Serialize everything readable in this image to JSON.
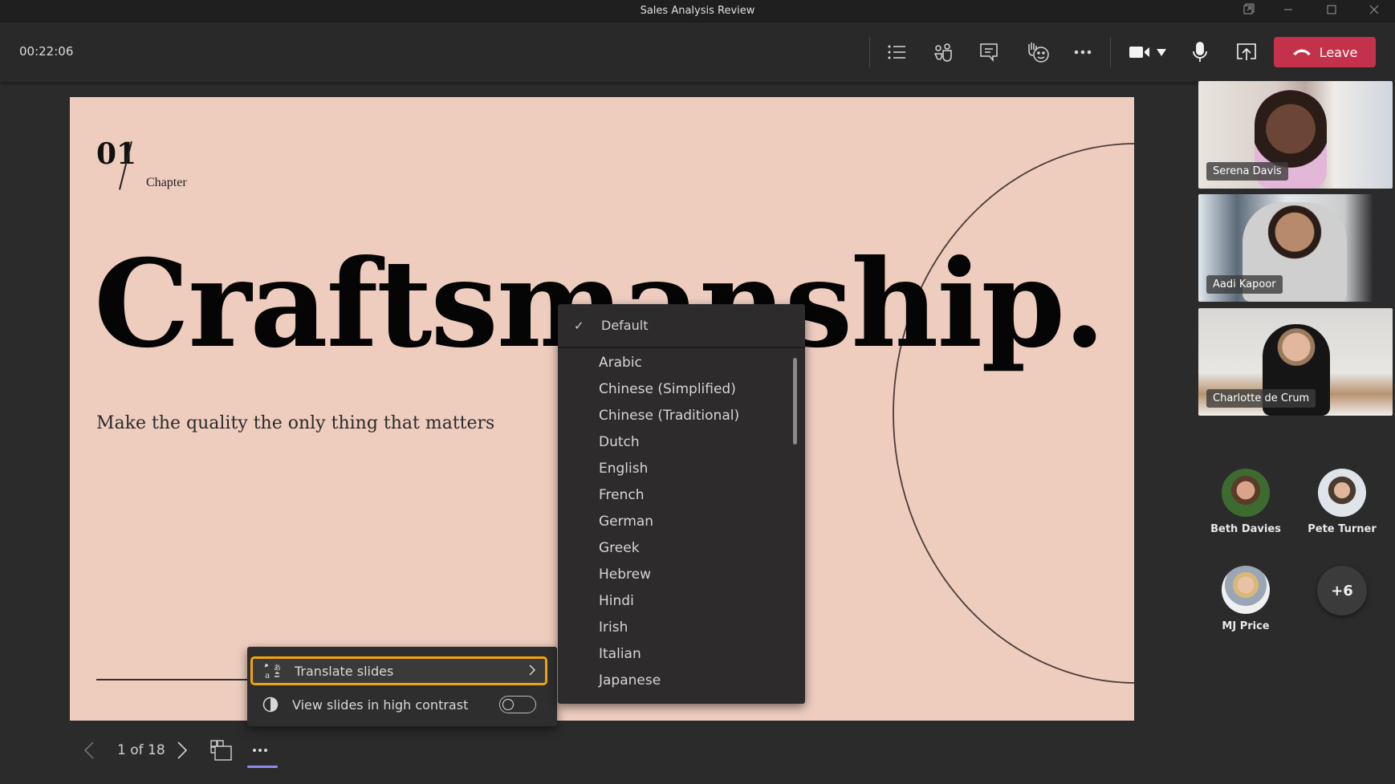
{
  "window": {
    "title": "Sales Analysis Review",
    "controls": [
      "popout-icon",
      "minimize-icon",
      "maximize-icon",
      "close-icon"
    ]
  },
  "toolbar": {
    "timer": "00:22:06",
    "buttons": [
      {
        "name": "agenda-list",
        "icon": "list-icon"
      },
      {
        "name": "participants",
        "icon": "people-icon"
      },
      {
        "name": "chat",
        "icon": "chat-icon"
      },
      {
        "name": "react",
        "icon": "raise-hand-emoji-icon"
      },
      {
        "name": "more-actions",
        "icon": "more-icon"
      },
      {
        "name": "camera",
        "icon": "video-camera-icon"
      },
      {
        "name": "camera-options",
        "icon": "caret-down-icon"
      },
      {
        "name": "microphone",
        "icon": "mic-icon"
      },
      {
        "name": "share",
        "icon": "share-screen-icon"
      }
    ],
    "leave_label": "Leave",
    "leave_color": "#c4314b"
  },
  "slide": {
    "chapter_number": "01",
    "chapter_label": "Chapter",
    "title": "Craftsmanship.",
    "subtitle": "Make the quality the only thing that matters",
    "background": "#eecdbf"
  },
  "participants": {
    "video_tiles": [
      {
        "name": "Serena Davis"
      },
      {
        "name": "Aadi Kapoor"
      },
      {
        "name": "Charlotte de Crum"
      }
    ],
    "avatars": [
      {
        "name": "Beth Davies"
      },
      {
        "name": "Pete Turner"
      },
      {
        "name": "MJ Price"
      }
    ],
    "overflow_count": "+6"
  },
  "context_menu": {
    "items": [
      {
        "label": "Translate slides",
        "icon": "translate-icon",
        "has_submenu": true,
        "focused": true
      },
      {
        "label": "View slides in high contrast",
        "icon": "contrast-icon",
        "toggle": false
      }
    ],
    "focus_color": "#f0a30a"
  },
  "language_menu": {
    "selected": "Default",
    "items": [
      "Arabic",
      "Chinese (Simplified)",
      "Chinese (Traditional)",
      "Dutch",
      "English",
      "French",
      "German",
      "Greek",
      "Hebrew",
      "Hindi",
      "Irish",
      "Italian",
      "Japanese"
    ]
  },
  "slide_nav": {
    "page_indicator": "1 of 18",
    "active_underline_color": "#8d8cf0"
  }
}
